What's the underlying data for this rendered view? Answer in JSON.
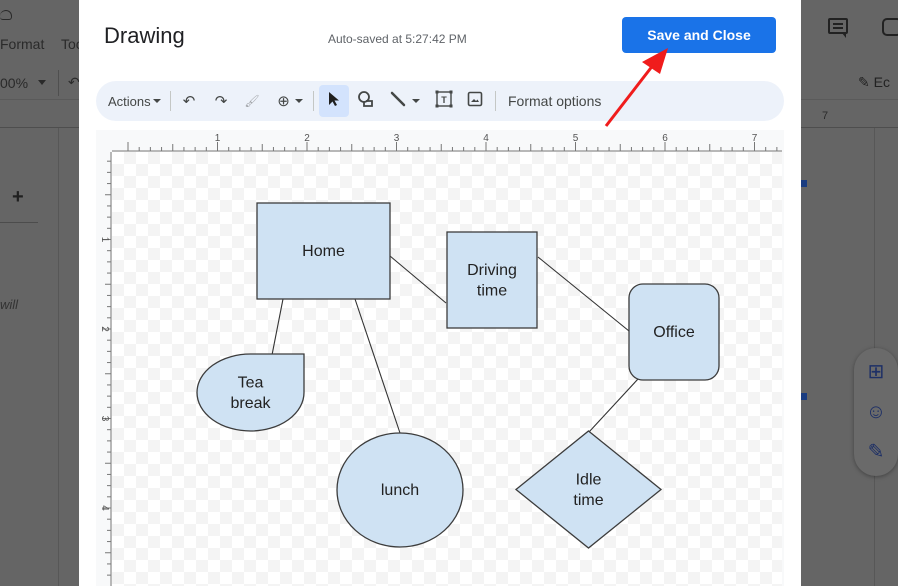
{
  "background_app": {
    "menu": [
      "Format",
      "Too"
    ],
    "zoom_value": "00%",
    "left_text_fragment": "will",
    "ruler_label": "7",
    "edit_label": "Ec",
    "side_actions": [
      {
        "icon": "add-comment-icon",
        "glyph": "⊞"
      },
      {
        "icon": "emoji-icon",
        "glyph": "☺"
      },
      {
        "icon": "suggest-edit-icon",
        "glyph": "✎"
      }
    ]
  },
  "dialog": {
    "title": "Drawing",
    "autosave": "Auto-saved at 5:27:42 PM",
    "save_close_label": "Save and Close"
  },
  "toolbar": {
    "actions_label": "Actions",
    "undo_glyph": "↶",
    "redo_glyph": "↷",
    "paint_format_glyph": "🖌",
    "zoom_glyph": "⊕",
    "select_glyph": "➤",
    "shape_glyph": "◯",
    "line_glyph": "╲",
    "textbox_glyph": "T",
    "image_glyph": "▣",
    "format_options_label": "Format options"
  },
  "rulers": {
    "horizontal": [
      "1",
      "2",
      "3",
      "4",
      "5",
      "6",
      "7"
    ],
    "vertical": [
      "1",
      "2",
      "3",
      "4"
    ]
  },
  "diagram": {
    "fill": "#cfe2f3",
    "stroke": "#3c3c3c",
    "nodes": [
      {
        "id": "home",
        "shape": "rectangle",
        "lines": [
          "Home"
        ]
      },
      {
        "id": "driving",
        "shape": "rectangle",
        "lines": [
          "Driving",
          "time"
        ]
      },
      {
        "id": "office",
        "shape": "rounded-rectangle",
        "lines": [
          "Office"
        ]
      },
      {
        "id": "tea",
        "shape": "teardrop",
        "lines": [
          "Tea",
          "break"
        ]
      },
      {
        "id": "lunch",
        "shape": "ellipse",
        "lines": [
          "lunch"
        ]
      },
      {
        "id": "idle",
        "shape": "diamond",
        "lines": [
          "Idle",
          "time"
        ]
      }
    ],
    "edges": [
      [
        "home",
        "driving"
      ],
      [
        "driving",
        "office"
      ],
      [
        "home",
        "tea"
      ],
      [
        "home",
        "lunch"
      ],
      [
        "office",
        "idle"
      ]
    ]
  },
  "annotation": {
    "arrow_color": "#f01c1c",
    "points_to": "save-and-close-button"
  }
}
